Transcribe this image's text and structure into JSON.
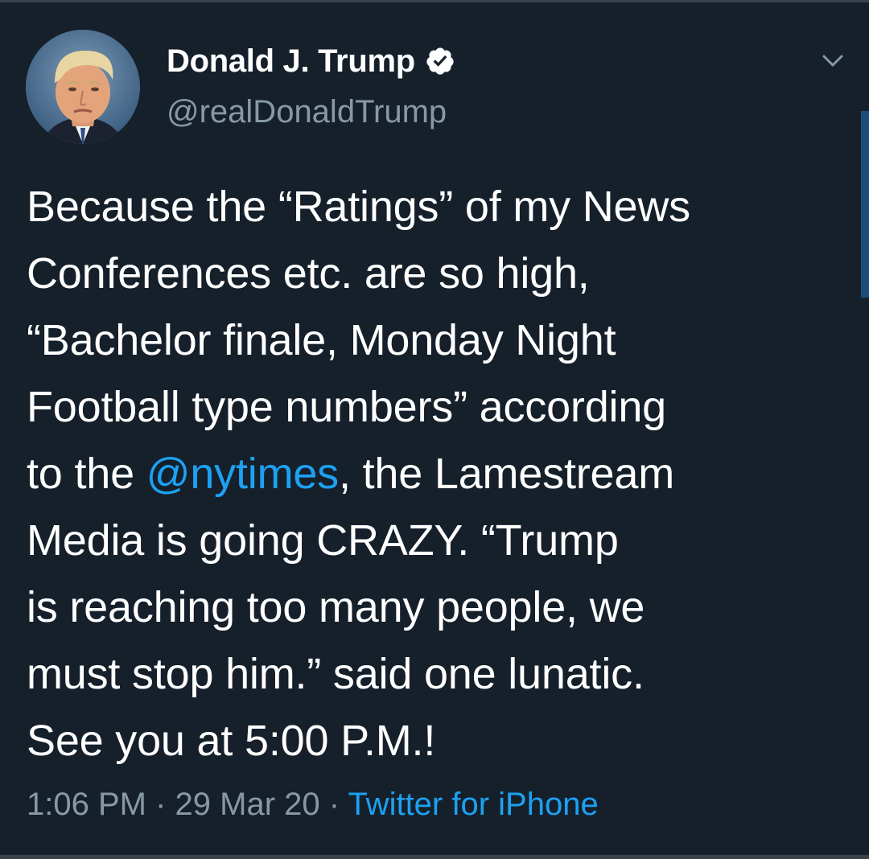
{
  "tweet": {
    "author": {
      "display_name": "Donald J. Trump",
      "handle": "@realDonaldTrump",
      "verified_icon": "verified-badge-icon"
    },
    "lines": [
      {
        "parts": [
          "Because the “Ratings” of my News"
        ]
      },
      {
        "parts": [
          "Conferences etc. are so high,"
        ]
      },
      {
        "parts": [
          "“Bachelor finale, Monday Night"
        ]
      },
      {
        "parts": [
          "Football type numbers” according"
        ]
      },
      {
        "before": "to the ",
        "mention": "@nytimes",
        "after": ", the Lamestream"
      },
      {
        "parts": [
          "Media is going CRAZY. “Trump"
        ]
      },
      {
        "parts": [
          "is reaching too many people, we"
        ]
      },
      {
        "parts": [
          "must stop him.” said one lunatic."
        ]
      },
      {
        "parts": [
          "See you at 5:00 P.M.!"
        ]
      }
    ],
    "meta": {
      "time": "1:06 PM",
      "separator": " · ",
      "date": "29 Mar 20",
      "source": "Twitter for iPhone"
    }
  },
  "colors": {
    "background": "#15202b",
    "text": "#ffffff",
    "secondary": "#8899a6",
    "accent": "#1da1f2"
  },
  "icons": {
    "menu": "chevron-down-icon"
  }
}
